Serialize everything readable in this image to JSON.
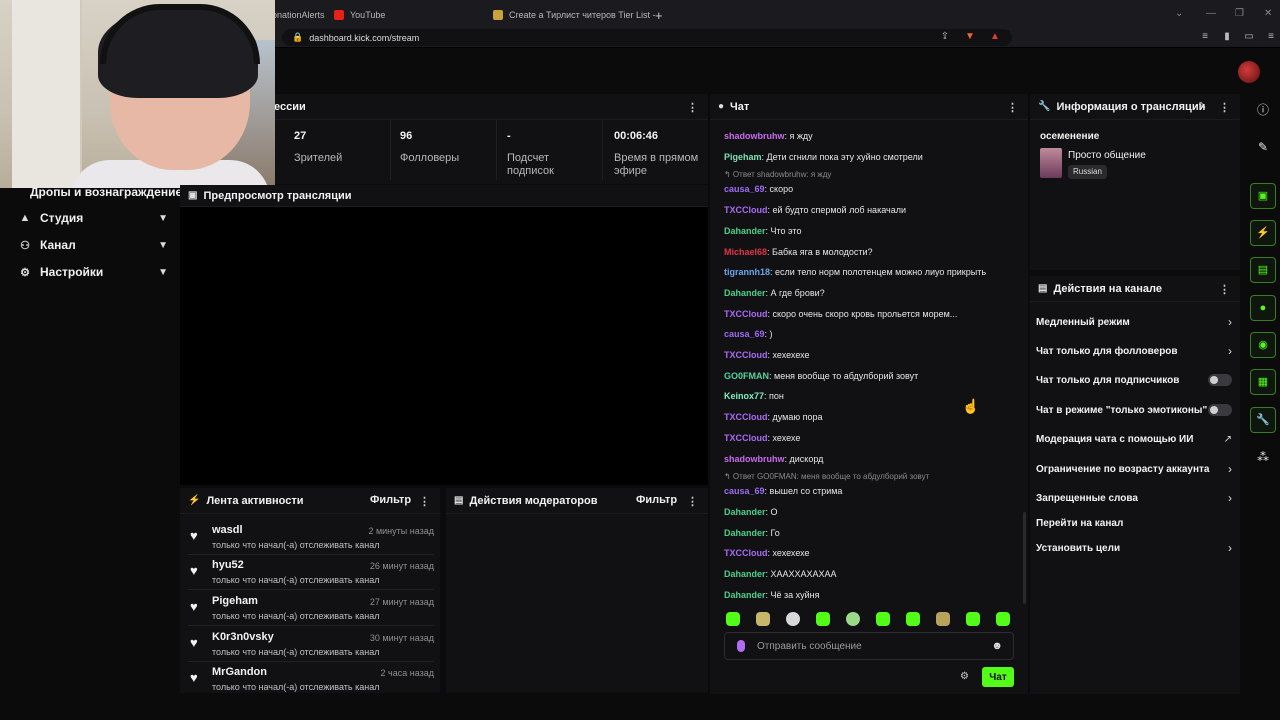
{
  "browser": {
    "tabs": [
      {
        "label": "onationAlerts"
      },
      {
        "label": "YouTube"
      },
      {
        "label": "Create a Тирлист читеров Tier List -"
      }
    ],
    "new_tab": "+",
    "url": "dashboard.kick.com/stream"
  },
  "nav": {
    "drops": "Дропы и вознаграждение",
    "studio": "Студия",
    "channel": "Канал",
    "settings": "Настройки"
  },
  "session": {
    "title": "ессии",
    "stats": [
      {
        "value": "27",
        "label": "Зрителей"
      },
      {
        "value": "96",
        "label": "Фолловеры"
      },
      {
        "value": "-",
        "label": "Подсчет подписок"
      },
      {
        "value": "00:06:46",
        "label": "Время в прямом эфире"
      }
    ]
  },
  "preview": {
    "title": "Предпросмотр трансляции"
  },
  "activity": {
    "title": "Лента активности",
    "filter": "Фильтр",
    "items": [
      {
        "name": "wasdl",
        "time": "2 минуты назад",
        "desc": "только что начал(-а) отслеживать канал"
      },
      {
        "name": "hyu52",
        "time": "26 минут назад",
        "desc": "только что начал(-а) отслеживать канал"
      },
      {
        "name": "Pigeham",
        "time": "27 минут назад",
        "desc": "только что начал(-а) отслеживать канал"
      },
      {
        "name": "K0r3n0vsky",
        "time": "30 минут назад",
        "desc": "только что начал(-а) отслеживать канал"
      },
      {
        "name": "MrGandon",
        "time": "2 часа назад",
        "desc": "только что начал(-а) отслеживать канал"
      }
    ]
  },
  "moderators": {
    "title": "Действия модераторов",
    "filter": "Фильтр"
  },
  "chat": {
    "title": "Чат",
    "messages": [
      {
        "user": "shadowbruhw",
        "color": "#c86bf0",
        "text": ": я жду"
      },
      {
        "user": "Pigeham",
        "color": "#7ee0b4",
        "text": ": Дети сгнили пока эту хуйно смотрели"
      },
      {
        "reply": "Ответ shadowbruhw: я жду"
      },
      {
        "user": "causa_69",
        "color": "#9b6cf5",
        "text": ": скоро"
      },
      {
        "user": "TXCCloud",
        "color": "#a86bf5",
        "text": ": ей будто спермой лоб накачали"
      },
      {
        "user": "Dahander",
        "color": "#4ccf8c",
        "text": ": Что это"
      },
      {
        "user": "Michael68",
        "color": "#e0344a",
        "text": ": Бабка яга в молодости?"
      },
      {
        "user": "tigrannh18",
        "color": "#6aa7f0",
        "text": ": если тело норм полотенцем можно лиуо прикрыть"
      },
      {
        "user": "Dahander",
        "color": "#4ccf8c",
        "text": ": А где брови?"
      },
      {
        "user": "TXCCloud",
        "color": "#a86bf5",
        "text": ": скоро очень скоро кровь прольется морем..."
      },
      {
        "user": "causa_69",
        "color": "#9b6cf5",
        "text": ": )"
      },
      {
        "user": "TXCCloud",
        "color": "#a86bf5",
        "text": ": хехехехе"
      },
      {
        "user": "GO0FMAN",
        "color": "#53d3a0",
        "text": ": меня вообще то абдулборий зовут"
      },
      {
        "user": "Keinox77",
        "color": "#7ef0c0",
        "text": ": пон"
      },
      {
        "user": "TXCCloud",
        "color": "#a86bf5",
        "text": ": думаю пора"
      },
      {
        "user": "TXCCloud",
        "color": "#a86bf5",
        "text": ": хехехе"
      },
      {
        "user": "shadowbruhw",
        "color": "#c86bf0",
        "text": ": дискорд"
      },
      {
        "reply": "Ответ GO0FMAN: меня вообще то абдулборий зовут"
      },
      {
        "user": "causa_69",
        "color": "#9b6cf5",
        "text": ": вышел со стрима"
      },
      {
        "user": "Dahander",
        "color": "#4ccf8c",
        "text": ": О"
      },
      {
        "user": "Dahander",
        "color": "#4ccf8c",
        "text": ": Го"
      },
      {
        "user": "TXCCloud",
        "color": "#a86bf5",
        "text": ": хехехехе"
      },
      {
        "user": "Dahander",
        "color": "#4ccf8c",
        "text": ": ХААХХАХАХАА"
      },
      {
        "user": "Dahander",
        "color": "#4ccf8c",
        "text": ": Чё за хуйня"
      }
    ],
    "placeholder": "Отправить сообщение",
    "send": "Чат"
  },
  "stream_info": {
    "title": "Информация о трансляции",
    "stream_title": "осеменение",
    "category": "Просто общение",
    "language": "Russian"
  },
  "channel_actions": {
    "title": "Действия на канале",
    "items": [
      {
        "label": "Медленный режим",
        "control": "arrow"
      },
      {
        "label": "Чат только для фолловеров",
        "control": "arrow"
      },
      {
        "label": "Чат только для подписчиков",
        "control": "toggle"
      },
      {
        "label": "Чат в режиме \"только эмотиконы\"",
        "control": "toggle"
      },
      {
        "label": "Модерация чата с помощью ИИ",
        "control": "external"
      },
      {
        "label": "Ограничение по возрасту аккаунта",
        "control": "arrow"
      },
      {
        "label": "Запрещенные слова",
        "control": "arrow"
      },
      {
        "label": "Перейти на канал",
        "control": "none"
      },
      {
        "label": "Установить цели",
        "control": "arrow"
      }
    ]
  },
  "accent": "#53fc18"
}
